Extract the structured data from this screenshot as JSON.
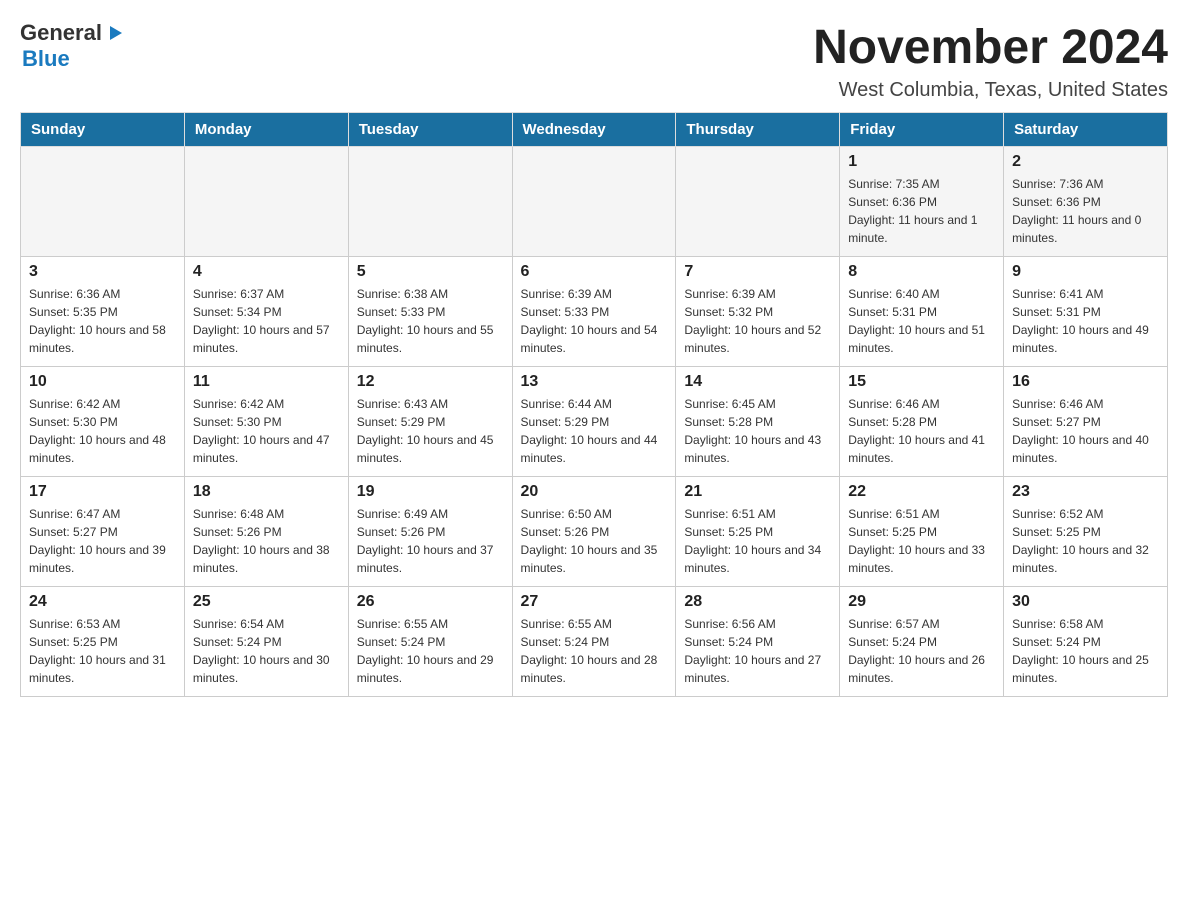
{
  "header": {
    "logo_general": "General",
    "logo_blue": "Blue",
    "title": "November 2024",
    "subtitle": "West Columbia, Texas, United States"
  },
  "calendar": {
    "days": [
      "Sunday",
      "Monday",
      "Tuesday",
      "Wednesday",
      "Thursday",
      "Friday",
      "Saturday"
    ],
    "weeks": [
      [
        {
          "day": "",
          "sunrise": "",
          "sunset": "",
          "daylight": ""
        },
        {
          "day": "",
          "sunrise": "",
          "sunset": "",
          "daylight": ""
        },
        {
          "day": "",
          "sunrise": "",
          "sunset": "",
          "daylight": ""
        },
        {
          "day": "",
          "sunrise": "",
          "sunset": "",
          "daylight": ""
        },
        {
          "day": "",
          "sunrise": "",
          "sunset": "",
          "daylight": ""
        },
        {
          "day": "1",
          "sunrise": "Sunrise: 7:35 AM",
          "sunset": "Sunset: 6:36 PM",
          "daylight": "Daylight: 11 hours and 1 minute."
        },
        {
          "day": "2",
          "sunrise": "Sunrise: 7:36 AM",
          "sunset": "Sunset: 6:36 PM",
          "daylight": "Daylight: 11 hours and 0 minutes."
        }
      ],
      [
        {
          "day": "3",
          "sunrise": "Sunrise: 6:36 AM",
          "sunset": "Sunset: 5:35 PM",
          "daylight": "Daylight: 10 hours and 58 minutes."
        },
        {
          "day": "4",
          "sunrise": "Sunrise: 6:37 AM",
          "sunset": "Sunset: 5:34 PM",
          "daylight": "Daylight: 10 hours and 57 minutes."
        },
        {
          "day": "5",
          "sunrise": "Sunrise: 6:38 AM",
          "sunset": "Sunset: 5:33 PM",
          "daylight": "Daylight: 10 hours and 55 minutes."
        },
        {
          "day": "6",
          "sunrise": "Sunrise: 6:39 AM",
          "sunset": "Sunset: 5:33 PM",
          "daylight": "Daylight: 10 hours and 54 minutes."
        },
        {
          "day": "7",
          "sunrise": "Sunrise: 6:39 AM",
          "sunset": "Sunset: 5:32 PM",
          "daylight": "Daylight: 10 hours and 52 minutes."
        },
        {
          "day": "8",
          "sunrise": "Sunrise: 6:40 AM",
          "sunset": "Sunset: 5:31 PM",
          "daylight": "Daylight: 10 hours and 51 minutes."
        },
        {
          "day": "9",
          "sunrise": "Sunrise: 6:41 AM",
          "sunset": "Sunset: 5:31 PM",
          "daylight": "Daylight: 10 hours and 49 minutes."
        }
      ],
      [
        {
          "day": "10",
          "sunrise": "Sunrise: 6:42 AM",
          "sunset": "Sunset: 5:30 PM",
          "daylight": "Daylight: 10 hours and 48 minutes."
        },
        {
          "day": "11",
          "sunrise": "Sunrise: 6:42 AM",
          "sunset": "Sunset: 5:30 PM",
          "daylight": "Daylight: 10 hours and 47 minutes."
        },
        {
          "day": "12",
          "sunrise": "Sunrise: 6:43 AM",
          "sunset": "Sunset: 5:29 PM",
          "daylight": "Daylight: 10 hours and 45 minutes."
        },
        {
          "day": "13",
          "sunrise": "Sunrise: 6:44 AM",
          "sunset": "Sunset: 5:29 PM",
          "daylight": "Daylight: 10 hours and 44 minutes."
        },
        {
          "day": "14",
          "sunrise": "Sunrise: 6:45 AM",
          "sunset": "Sunset: 5:28 PM",
          "daylight": "Daylight: 10 hours and 43 minutes."
        },
        {
          "day": "15",
          "sunrise": "Sunrise: 6:46 AM",
          "sunset": "Sunset: 5:28 PM",
          "daylight": "Daylight: 10 hours and 41 minutes."
        },
        {
          "day": "16",
          "sunrise": "Sunrise: 6:46 AM",
          "sunset": "Sunset: 5:27 PM",
          "daylight": "Daylight: 10 hours and 40 minutes."
        }
      ],
      [
        {
          "day": "17",
          "sunrise": "Sunrise: 6:47 AM",
          "sunset": "Sunset: 5:27 PM",
          "daylight": "Daylight: 10 hours and 39 minutes."
        },
        {
          "day": "18",
          "sunrise": "Sunrise: 6:48 AM",
          "sunset": "Sunset: 5:26 PM",
          "daylight": "Daylight: 10 hours and 38 minutes."
        },
        {
          "day": "19",
          "sunrise": "Sunrise: 6:49 AM",
          "sunset": "Sunset: 5:26 PM",
          "daylight": "Daylight: 10 hours and 37 minutes."
        },
        {
          "day": "20",
          "sunrise": "Sunrise: 6:50 AM",
          "sunset": "Sunset: 5:26 PM",
          "daylight": "Daylight: 10 hours and 35 minutes."
        },
        {
          "day": "21",
          "sunrise": "Sunrise: 6:51 AM",
          "sunset": "Sunset: 5:25 PM",
          "daylight": "Daylight: 10 hours and 34 minutes."
        },
        {
          "day": "22",
          "sunrise": "Sunrise: 6:51 AM",
          "sunset": "Sunset: 5:25 PM",
          "daylight": "Daylight: 10 hours and 33 minutes."
        },
        {
          "day": "23",
          "sunrise": "Sunrise: 6:52 AM",
          "sunset": "Sunset: 5:25 PM",
          "daylight": "Daylight: 10 hours and 32 minutes."
        }
      ],
      [
        {
          "day": "24",
          "sunrise": "Sunrise: 6:53 AM",
          "sunset": "Sunset: 5:25 PM",
          "daylight": "Daylight: 10 hours and 31 minutes."
        },
        {
          "day": "25",
          "sunrise": "Sunrise: 6:54 AM",
          "sunset": "Sunset: 5:24 PM",
          "daylight": "Daylight: 10 hours and 30 minutes."
        },
        {
          "day": "26",
          "sunrise": "Sunrise: 6:55 AM",
          "sunset": "Sunset: 5:24 PM",
          "daylight": "Daylight: 10 hours and 29 minutes."
        },
        {
          "day": "27",
          "sunrise": "Sunrise: 6:55 AM",
          "sunset": "Sunset: 5:24 PM",
          "daylight": "Daylight: 10 hours and 28 minutes."
        },
        {
          "day": "28",
          "sunrise": "Sunrise: 6:56 AM",
          "sunset": "Sunset: 5:24 PM",
          "daylight": "Daylight: 10 hours and 27 minutes."
        },
        {
          "day": "29",
          "sunrise": "Sunrise: 6:57 AM",
          "sunset": "Sunset: 5:24 PM",
          "daylight": "Daylight: 10 hours and 26 minutes."
        },
        {
          "day": "30",
          "sunrise": "Sunrise: 6:58 AM",
          "sunset": "Sunset: 5:24 PM",
          "daylight": "Daylight: 10 hours and 25 minutes."
        }
      ]
    ]
  }
}
